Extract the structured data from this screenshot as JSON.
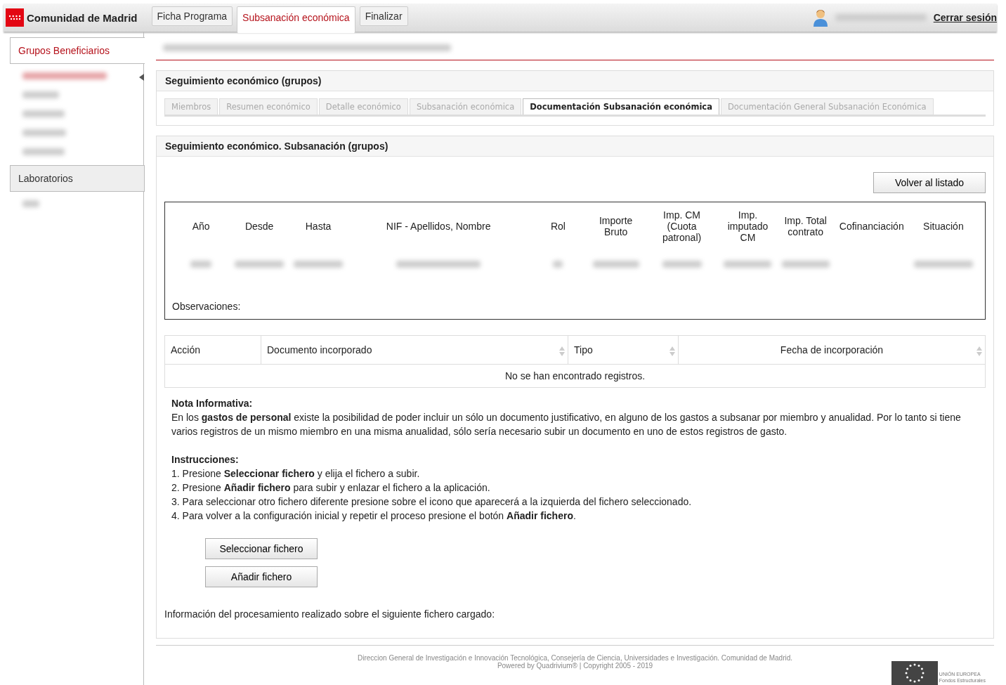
{
  "header": {
    "brand": "Comunidad de Madrid",
    "tabs": [
      {
        "label": "Ficha Programa",
        "selected": false
      },
      {
        "label": "Subsanación económica",
        "selected": true
      },
      {
        "label": "Finalizar",
        "selected": false
      }
    ],
    "logout": "Cerrar sesión"
  },
  "sidebar": {
    "sections": [
      {
        "title": "Grupos Beneficiarios",
        "selected": true
      },
      {
        "title": "Laboratorios",
        "selected": false
      }
    ]
  },
  "panel_tracking": {
    "title": "Seguimiento económico (grupos)",
    "tabs": [
      {
        "label": "Miembros",
        "selected": false
      },
      {
        "label": "Resumen económico",
        "selected": false
      },
      {
        "label": "Detalle económico",
        "selected": false
      },
      {
        "label": "Subsanación económica",
        "selected": false
      },
      {
        "label": "Documentación Subsanación económica",
        "selected": true
      },
      {
        "label": "Documentación General Subsanación Económica",
        "selected": false
      }
    ]
  },
  "panel_subsanacion": {
    "title": "Seguimiento económico. Subsanación (grupos)",
    "back_button": "Volver al listado",
    "summary_table": {
      "columns": [
        "Año",
        "Desde",
        "Hasta",
        "NIF - Apellidos, Nombre",
        "Rol",
        "Importe Bruto",
        "Imp. CM (Cuota patronal)",
        "Imp. imputado CM",
        "Imp. Total contrato",
        "Cofinanciación",
        "Situación"
      ],
      "observations_label": "Observaciones:"
    },
    "documents_table": {
      "columns": [
        {
          "label": "Acción",
          "sortable": false
        },
        {
          "label": "Documento incorporado",
          "sortable": true
        },
        {
          "label": "Tipo",
          "sortable": true
        },
        {
          "label": "Fecha de incorporación",
          "sortable": true
        }
      ],
      "empty_message": "No se han encontrado registros."
    },
    "note": {
      "heading": "Nota Informativa:",
      "text": "En los **gastos de personal** existe la posibilidad de poder incluir un sólo un documento justificativo, en alguno de los gastos a subsanar por miembro y anualidad. Por lo tanto si tiene varios registros de un mismo miembro en una misma anualidad, sólo sería necesario subir un documento en uno de estos registros de gasto."
    },
    "instructions": {
      "heading": "Instrucciones:",
      "steps": [
        "1. Presione **Seleccionar fichero** y elija el fichero a subir.",
        "2. Presione **Añadir fichero** para subir y enlazar el fichero a la aplicación.",
        "3. Para seleccionar otro fichero diferente presione sobre el icono que aparecerá a la izquierda del fichero seleccionado.",
        "4. Para volver a la configuración inicial y repetir el proceso presione el botón **Añadir fichero**."
      ]
    },
    "buttons": [
      "Seleccionar fichero",
      "Añadir fichero"
    ],
    "processing_info": "Información del procesamiento realizado sobre el siguiente fichero cargado:"
  },
  "footer": {
    "lines": [
      "Direccion General de Investigación e Innovación Tecnológica, Consejería de Ciencia, Universidades e Investigación. Comunidad de Madrid.",
      "Powered by Quadrivium® | Copyright 2005 - 2019"
    ],
    "eu_logo": [
      "UNIÓN EUROPEA",
      "Fondos Estructurales"
    ]
  }
}
